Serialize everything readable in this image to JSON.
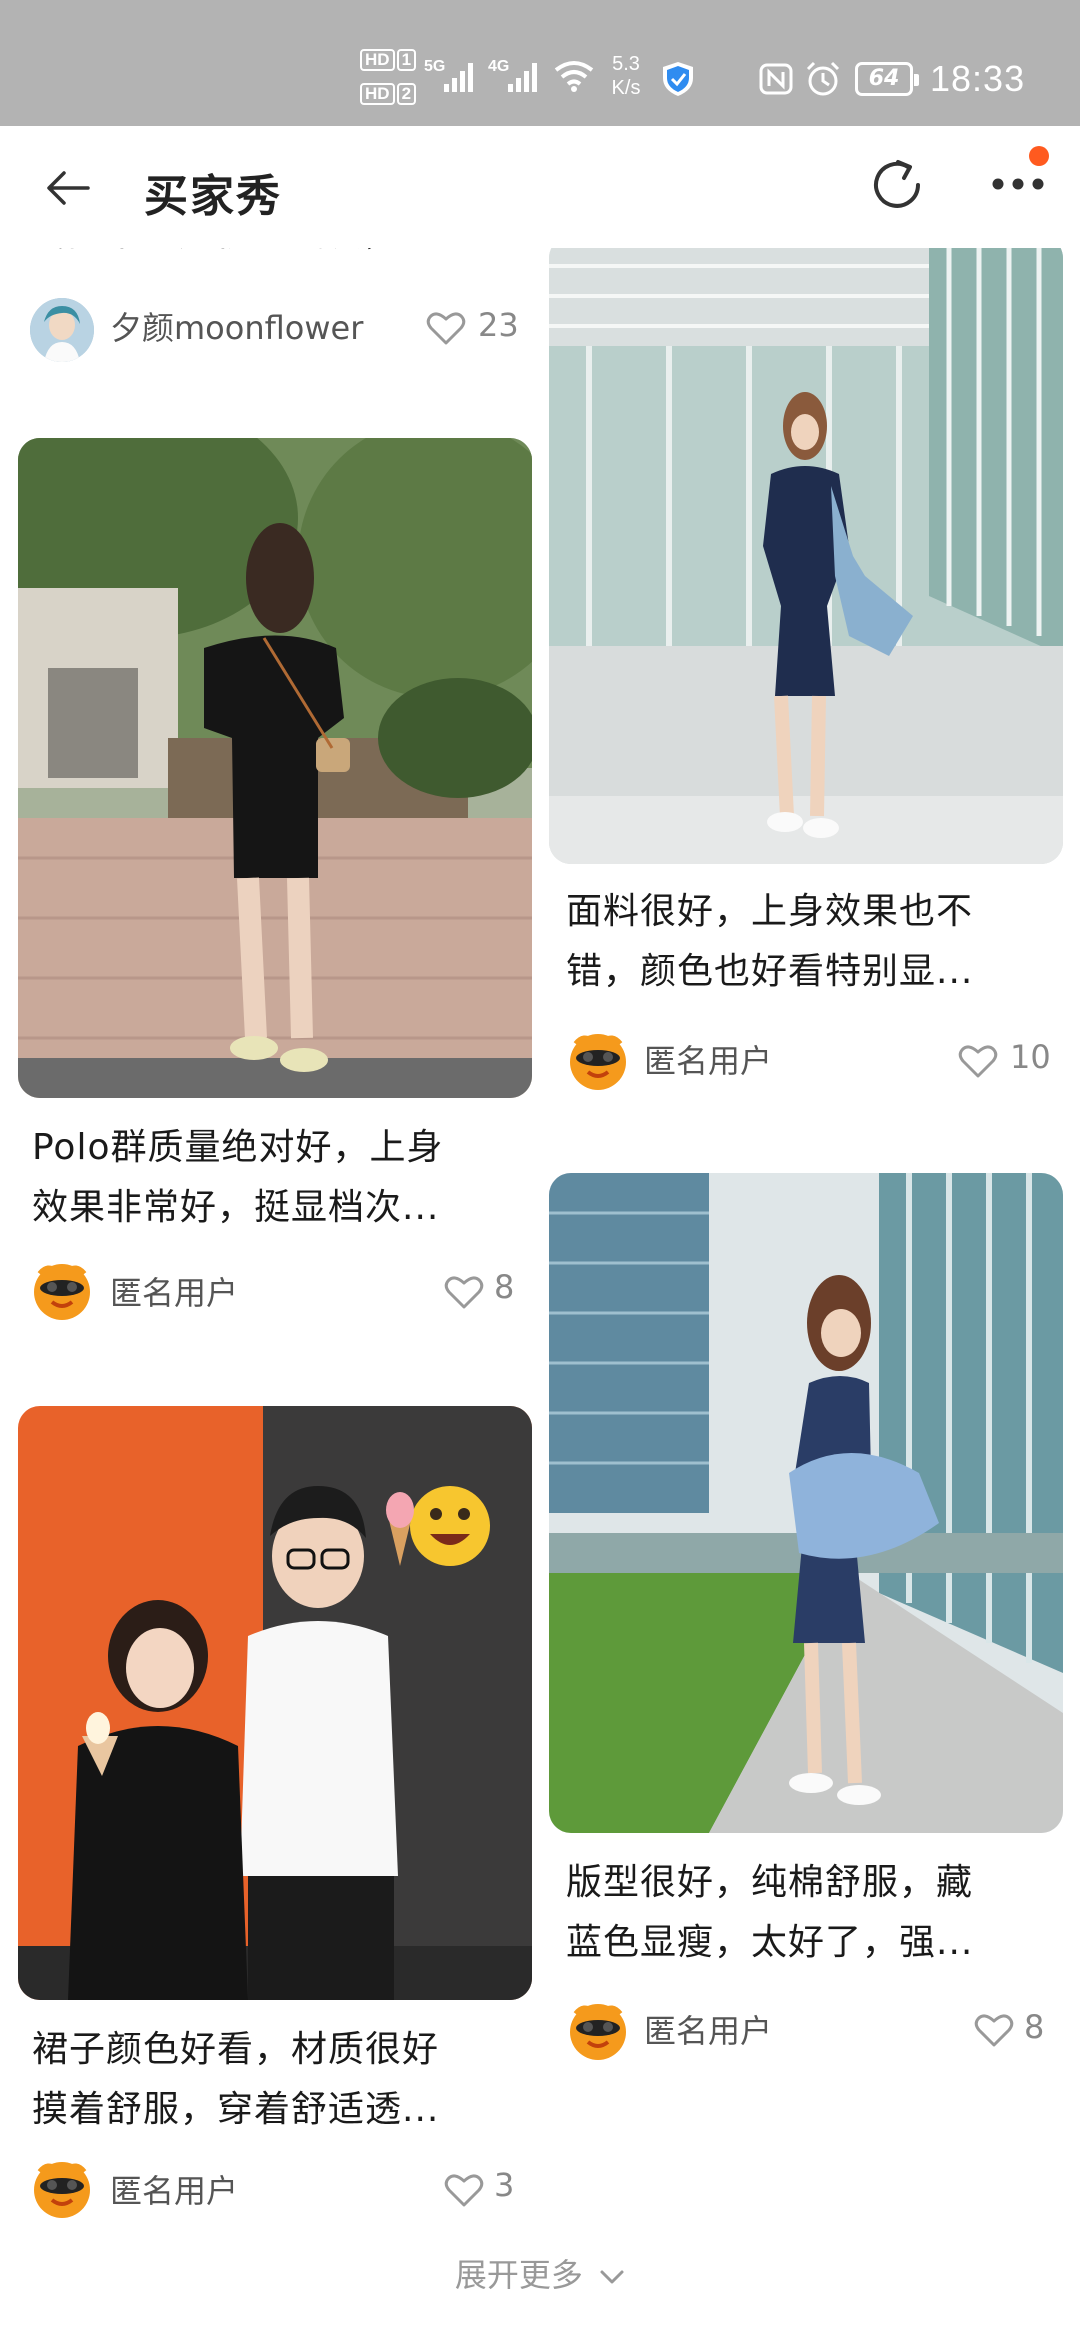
{
  "status_bar": {
    "hd1": "HD",
    "hd1_num": "1",
    "hd2": "HD",
    "hd2_num": "2",
    "net1": "5G",
    "net2": "4G",
    "speed_value": "5.3",
    "speed_unit": "K/s",
    "battery": "64",
    "time": "18:33"
  },
  "nav": {
    "title": "买家秀"
  },
  "posts": [
    {
      "caption_partial": "式简单但是很显气质，...",
      "username": "夕颜moonflower",
      "likes": "23"
    },
    {
      "caption_line1": "面料很好，上身效果也不",
      "caption_line2": "错，颜色也好看特别显...",
      "username": "匿名用户",
      "likes": "10"
    },
    {
      "caption_line1": "Polo群质量绝对好，上身",
      "caption_line2": "效果非常好，挺显档次...",
      "username": "匿名用户",
      "likes": "8"
    },
    {
      "caption_line1": "版型很好，纯棉舒服，藏",
      "caption_line2": "蓝色显瘦，太好了，强...",
      "username": "匿名用户",
      "likes": "8"
    },
    {
      "caption_line1": "裙子颜色好看，材质很好",
      "caption_line2": "摸着舒服，穿着舒适透...",
      "username": "匿名用户",
      "likes": "3"
    }
  ],
  "footer": {
    "expand_more": "展开更多"
  },
  "colors": {
    "status_bar_bg": "#b3b3b3",
    "notification_dot": "#ff5a1f",
    "muted_text": "#888888"
  },
  "icons": [
    "back-arrow-icon",
    "refresh-icon",
    "more-dots-icon",
    "heart-outline-icon",
    "chevron-down-icon",
    "wifi-icon",
    "signal-icon",
    "shield-icon",
    "nfc-icon",
    "alarm-icon",
    "battery-icon"
  ]
}
